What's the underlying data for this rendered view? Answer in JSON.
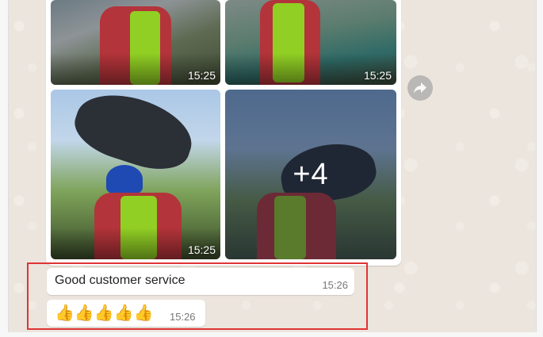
{
  "media": {
    "tiles": [
      {
        "time": "15:25"
      },
      {
        "time": "15:25"
      },
      {
        "time": "15:25"
      },
      {
        "more_count": "+4"
      }
    ]
  },
  "messages": [
    {
      "text": "Good customer service",
      "time": "15:26"
    },
    {
      "emoji": "👍👍👍👍👍",
      "time": "15:26"
    }
  ],
  "colors": {
    "highlight_border": "#e03434",
    "chat_background": "#ece5dd",
    "bubble": "#ffffff"
  },
  "icons": {
    "forward": "forward-arrow-icon",
    "reaction": "thumbs-up-emoji"
  }
}
